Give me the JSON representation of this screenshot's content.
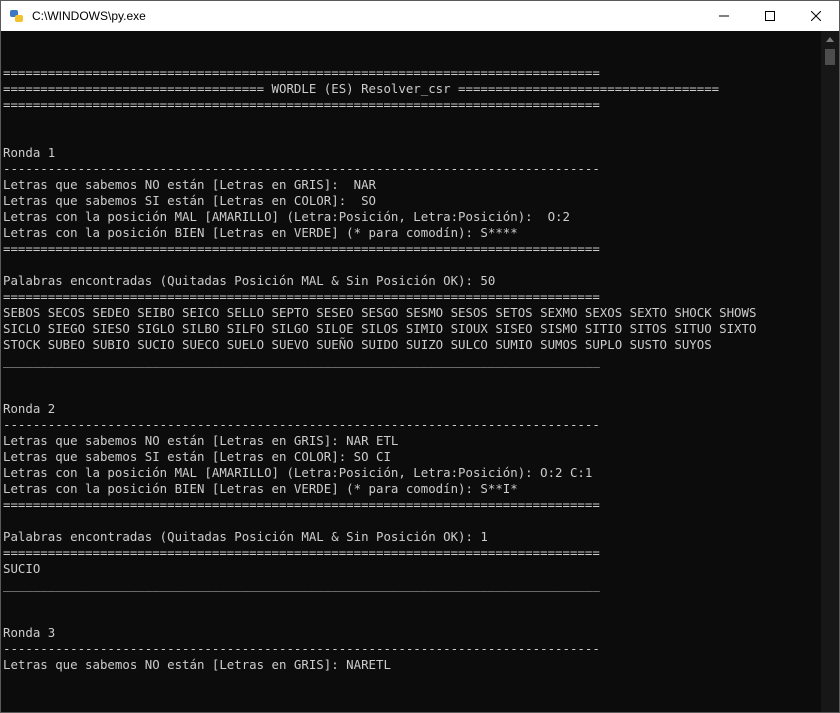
{
  "window": {
    "title": "C:\\WINDOWS\\py.exe",
    "minimize_glyph": "—",
    "icon": "python-icon"
  },
  "console": {
    "lines": [
      "================================================================================",
      "=================================== WORDLE (ES) Resolver_csr ===================================",
      "================================================================================",
      "",
      "",
      "Ronda 1",
      "--------------------------------------------------------------------------------",
      "Letras que sabemos NO están [Letras en GRIS]:  NAR",
      "Letras que sabemos SI están [Letras en COLOR]:  SO",
      "Letras con la posición MAL [AMARILLO] (Letra:Posición, Letra:Posición):  O:2",
      "Letras con la posición BIEN [Letras en VERDE] (* para comodín): S****",
      "================================================================================",
      "",
      "Palabras encontradas (Quitadas Posición MAL & Sin Posición OK): 50",
      "================================================================================",
      "SEBOS SECOS SEDEO SEIBO SEICO SELLO SEPTO SESEO SESGO SESMO SESOS SETOS SEXMO SEXOS SEXTO SHOCK SHOWS",
      "SICLO SIEGO SIESO SIGLO SILBO SILFO SILGO SILOE SILOS SIMIO SIOUX SISEO SISMO SITIO SITOS SITUO SIXTO",
      "STOCK SUBEO SUBIO SUCIO SUECO SUELO SUEVO SUEÑO SUIDO SUIZO SULCO SUMIO SUMOS SUPLO SUSTO SUYOS",
      "________________________________________________________________________________",
      "",
      "",
      "Ronda 2",
      "--------------------------------------------------------------------------------",
      "Letras que sabemos NO están [Letras en GRIS]: NAR ETL",
      "Letras que sabemos SI están [Letras en COLOR]: SO CI",
      "Letras con la posición MAL [AMARILLO] (Letra:Posición, Letra:Posición): O:2 C:1",
      "Letras con la posición BIEN [Letras en VERDE] (* para comodín): S**I*",
      "================================================================================",
      "",
      "Palabras encontradas (Quitadas Posición MAL & Sin Posición OK): 1",
      "================================================================================",
      "SUCIO",
      "________________________________________________________________________________",
      "",
      "",
      "Ronda 3",
      "--------------------------------------------------------------------------------",
      "Letras que sabemos NO están [Letras en GRIS]: NARETL"
    ]
  }
}
